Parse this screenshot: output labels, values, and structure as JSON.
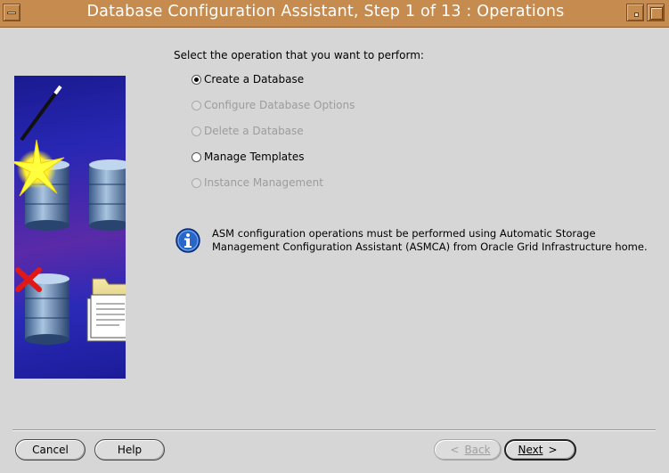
{
  "window": {
    "title": "Database Configuration Assistant, Step 1 of 13 : Operations"
  },
  "main": {
    "prompt": "Select the operation that you want to perform:",
    "options": [
      {
        "label": "Create a Database",
        "selected": true,
        "enabled": true
      },
      {
        "label": "Configure Database Options",
        "selected": false,
        "enabled": false
      },
      {
        "label": "Delete a Database",
        "selected": false,
        "enabled": false
      },
      {
        "label": "Manage Templates",
        "selected": false,
        "enabled": true
      },
      {
        "label": "Instance Management",
        "selected": false,
        "enabled": false
      }
    ],
    "info": {
      "icon": "info-icon",
      "line1": "ASM configuration operations must be performed using Automatic Storage",
      "line2": "Management Configuration Assistant (ASMCA) from Oracle Grid Infrastructure home."
    }
  },
  "buttons": {
    "cancel": "Cancel",
    "help": "Help",
    "back": "Back",
    "next": "Next",
    "back_arrow": "<",
    "next_arrow": ">"
  },
  "colors": {
    "titlebar": "#c68b4f",
    "background": "#d6d6d6",
    "artwork_bg": "#2727b4"
  }
}
